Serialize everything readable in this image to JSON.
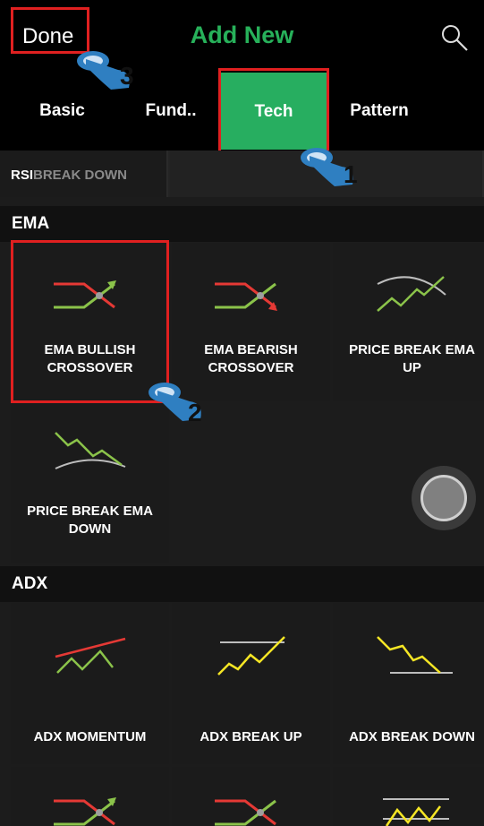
{
  "header": {
    "done_label": "Done",
    "title": "Add New",
    "search_icon": "search-icon"
  },
  "tabs": [
    {
      "label": "Basic",
      "active": false
    },
    {
      "label": "Fund..",
      "active": false
    },
    {
      "label": "Tech",
      "active": true
    },
    {
      "label": "Pattern",
      "active": false
    }
  ],
  "rsi_strip": {
    "prefix": "RSI",
    "suffix": "BREAK DOWN"
  },
  "sections": {
    "ema": {
      "title": "EMA",
      "items": [
        {
          "line1": "EMA BULLISH",
          "line2": "CROSSOVER",
          "icon": "bullish-crossover-icon"
        },
        {
          "line1": "EMA BEARISH",
          "line2": "CROSSOVER",
          "icon": "bearish-crossover-icon"
        },
        {
          "line1": "PRICE BREAK EMA",
          "line2": "UP",
          "icon": "price-break-up-icon"
        },
        {
          "line1": "PRICE BREAK EMA",
          "line2": "DOWN",
          "icon": "price-break-down-icon"
        }
      ]
    },
    "adx": {
      "title": "ADX",
      "items": [
        {
          "label": "ADX MOMENTUM",
          "icon": "adx-momentum-icon"
        },
        {
          "label": "ADX BREAK UP",
          "icon": "adx-break-up-icon"
        },
        {
          "label": "ADX BREAK DOWN",
          "icon": "adx-break-down-icon"
        }
      ]
    }
  },
  "annotations": {
    "steps": [
      "1",
      "2",
      "3"
    ],
    "hand_icon": "tap-hand-icon"
  },
  "colors": {
    "accent_green": "#27ae60",
    "highlight_red": "#e02020",
    "line_red": "#e53935",
    "line_green": "#8bc34a",
    "line_yellow": "#f5e625",
    "hand_blue": "#2f7fc1"
  }
}
